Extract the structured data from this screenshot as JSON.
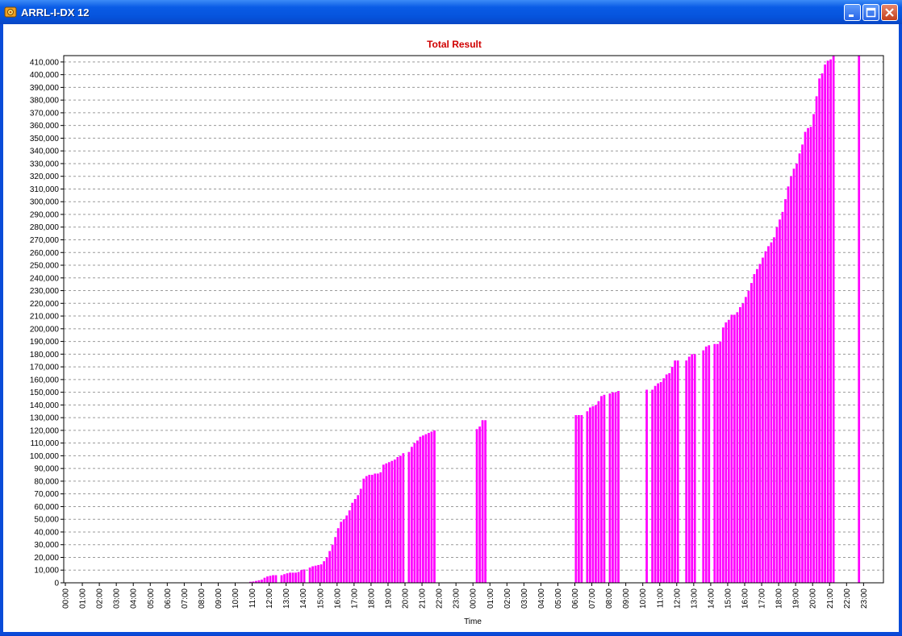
{
  "window": {
    "title": "ARRL-I-DX 12"
  },
  "colors": {
    "bar": "#ff00ff",
    "title": "#d00000",
    "grid": "#9a9a9a",
    "axis": "#000000"
  },
  "icons": {
    "app": "app-icon",
    "minimize": "minimize-icon",
    "maximize": "maximize-icon",
    "close": "close-icon"
  },
  "chart_data": {
    "type": "bar",
    "title": "Total Result",
    "xlabel": "Time",
    "ylabel": "",
    "ylim": [
      0,
      415000
    ],
    "ytick_step": 10000,
    "ytick_labels": [
      "0",
      "10,000",
      "20,000",
      "30,000",
      "40,000",
      "50,000",
      "60,000",
      "70,000",
      "80,000",
      "90,000",
      "100,000",
      "110,000",
      "120,000",
      "130,000",
      "140,000",
      "150,000",
      "160,000",
      "170,000",
      "180,000",
      "190,000",
      "200,000",
      "210,000",
      "220,000",
      "230,000",
      "240,000",
      "250,000",
      "260,000",
      "270,000",
      "280,000",
      "290,000",
      "300,000",
      "310,000",
      "320,000",
      "330,000",
      "340,000",
      "350,000",
      "360,000",
      "370,000",
      "380,000",
      "390,000",
      "400,000",
      "410,000"
    ],
    "xtick_labels": [
      "00:00",
      "01:00",
      "02:00",
      "03:00",
      "04:00",
      "05:00",
      "06:00",
      "07:00",
      "08:00",
      "09:00",
      "10:00",
      "11:00",
      "12:00",
      "13:00",
      "14:00",
      "15:00",
      "16:00",
      "17:00",
      "18:00",
      "19:00",
      "20:00",
      "21:00",
      "22:00",
      "23:00",
      "00:00",
      "01:00",
      "02:00",
      "03:00",
      "04:00",
      "05:00",
      "06:00",
      "07:00",
      "08:00",
      "09:00",
      "10:00",
      "11:00",
      "12:00",
      "13:00",
      "14:00",
      "15:00",
      "16:00",
      "17:00",
      "18:00",
      "19:00",
      "20:00",
      "21:00",
      "22:00",
      "23:00"
    ],
    "bar_interval_minutes": 10,
    "hourly": [
      [
        null,
        null,
        null,
        null,
        null,
        null
      ],
      [
        null,
        null,
        null,
        null,
        null,
        null
      ],
      [
        null,
        null,
        null,
        null,
        null,
        null
      ],
      [
        null,
        null,
        null,
        null,
        null,
        null
      ],
      [
        null,
        null,
        null,
        null,
        null,
        null
      ],
      [
        null,
        null,
        null,
        null,
        null,
        null
      ],
      [
        null,
        null,
        null,
        null,
        null,
        null
      ],
      [
        null,
        null,
        null,
        null,
        null,
        null
      ],
      [
        null,
        300,
        null,
        null,
        null,
        null
      ],
      [
        null,
        null,
        null,
        null,
        null,
        null
      ],
      [
        null,
        null,
        null,
        null,
        null,
        800
      ],
      [
        1000,
        1500,
        2000,
        2500,
        4000,
        5000
      ],
      [
        5500,
        6000,
        6000,
        null,
        6000,
        6800
      ],
      [
        7500,
        8000,
        8000,
        8000,
        8500,
        10000
      ],
      [
        10500,
        null,
        12000,
        13000,
        13500,
        14000
      ],
      [
        14500,
        17000,
        20000,
        25000,
        30000,
        36000
      ],
      [
        43000,
        48000,
        50000,
        53000,
        57000,
        63000
      ],
      [
        66000,
        69000,
        74000,
        82000,
        84000,
        85000
      ],
      [
        85000,
        86000,
        86000,
        87000,
        93000,
        94000
      ],
      [
        95000,
        96000,
        97000,
        99000,
        100000,
        102000
      ],
      [
        null,
        103000,
        107000,
        110000,
        112000,
        115000
      ],
      [
        116000,
        117000,
        118000,
        119000,
        120000,
        null
      ],
      [
        null,
        null,
        null,
        null,
        null,
        null
      ],
      [
        null,
        null,
        null,
        null,
        null,
        null
      ],
      [
        null,
        121000,
        123000,
        128000,
        128000,
        null
      ],
      [
        null,
        null,
        null,
        null,
        null,
        null
      ],
      [
        null,
        null,
        null,
        null,
        null,
        null
      ],
      [
        null,
        null,
        null,
        null,
        null,
        null
      ],
      [
        null,
        null,
        null,
        null,
        null,
        null
      ],
      [
        null,
        null,
        null,
        null,
        null,
        null
      ],
      [
        132000,
        132000,
        132000,
        null,
        135000,
        138000
      ],
      [
        139000,
        140000,
        143000,
        147000,
        148000,
        null
      ],
      [
        149000,
        150000,
        150000,
        151000,
        null,
        null
      ],
      [
        null,
        null,
        null,
        null,
        null,
        null
      ],
      [
        null,
        152000,
        null,
        152000,
        155000,
        157000
      ],
      [
        158000,
        161000,
        164000,
        165000,
        170000,
        175000
      ],
      [
        175000,
        null,
        null,
        175000,
        178000,
        180000
      ],
      [
        180000,
        null,
        null,
        183000,
        186000,
        187000
      ],
      [
        null,
        188000,
        188000,
        190000,
        201000,
        205000
      ],
      [
        207000,
        211000,
        211000,
        213000,
        217000,
        220000
      ],
      [
        225000,
        230000,
        236000,
        243000,
        247000,
        251000
      ],
      [
        256000,
        261000,
        265000,
        268000,
        272000,
        280000
      ],
      [
        286000,
        292000,
        302000,
        312000,
        320000,
        326000
      ],
      [
        330000,
        338000,
        345000,
        355000,
        358000,
        359000
      ],
      [
        369000,
        383000,
        397000,
        401000,
        408000,
        411000
      ],
      [
        412000,
        415000,
        null,
        null,
        null,
        null
      ],
      [
        null,
        null,
        null,
        null,
        415000,
        null
      ]
    ]
  }
}
